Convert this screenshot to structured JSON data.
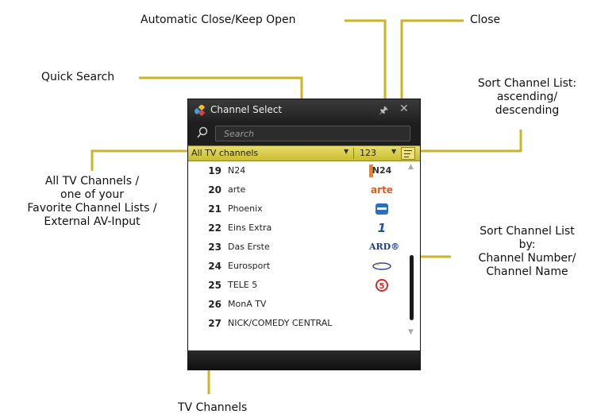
{
  "annotations": {
    "auto_close": "Automatic Close/Keep Open",
    "close": "Close",
    "quick_search": "Quick Search",
    "sort_order": [
      "Sort Channel List:",
      "ascending/",
      "descending"
    ],
    "channel_filter": [
      "All TV Channels /",
      "one of your",
      "Favorite Channel Lists /",
      "External AV-Input"
    ],
    "sort_by": [
      "Sort Channel List",
      "by:",
      "Channel Number/",
      "Channel Name"
    ],
    "tv_channels": "TV Channels"
  },
  "window": {
    "title": "Channel Select",
    "search_placeholder": "Search",
    "filter_selected": "All TV channels",
    "sort_selected": "123"
  },
  "channels": [
    {
      "number": "19",
      "name": "N24",
      "logo": "N24",
      "logo_color": "#333333"
    },
    {
      "number": "20",
      "name": "arte",
      "logo": "arte",
      "logo_color": "#e05a1c"
    },
    {
      "number": "21",
      "name": "Phoenix",
      "logo": "",
      "logo_color": "#2a6ebd"
    },
    {
      "number": "22",
      "name": "Eins Extra",
      "logo": "1",
      "logo_color": "#1d4fa3"
    },
    {
      "number": "23",
      "name": "Das Erste",
      "logo": "ARD®",
      "logo_color": "#1d3f8a"
    },
    {
      "number": "24",
      "name": "Eurosport",
      "logo": "",
      "logo_color": "#2a4f9a"
    },
    {
      "number": "25",
      "name": "TELE 5",
      "logo": "5",
      "logo_color": "#d42a2a"
    },
    {
      "number": "26",
      "name": "MonA TV",
      "logo": "",
      "logo_color": "#ffffff"
    },
    {
      "number": "27",
      "name": "NICK/COMEDY CENTRAL",
      "logo": "",
      "logo_color": "#ffffff"
    }
  ],
  "colors": {
    "callout_line": "#c9b526",
    "filter_bar": "#dcd24f",
    "window_dark": "#2a2a2a",
    "scroll_thumb": "#1a1a1a"
  },
  "icons": [
    "app-logo-icon",
    "pin-icon",
    "close-icon",
    "search-icon",
    "dropdown-icon",
    "sort-order-icon",
    "scroll-up-icon",
    "scroll-down-icon"
  ]
}
